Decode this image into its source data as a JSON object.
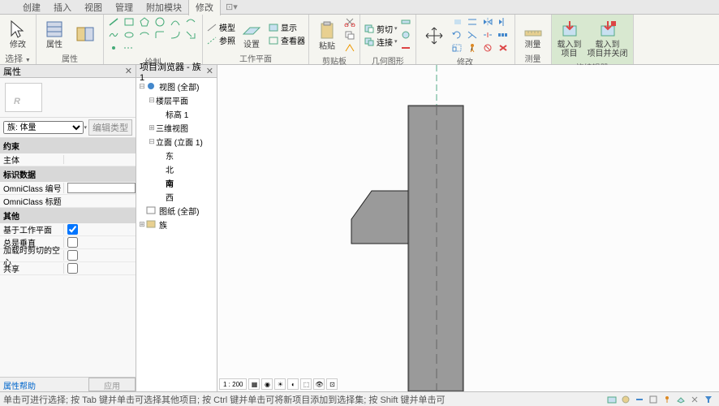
{
  "tabs": [
    "创建",
    "插入",
    "视图",
    "管理",
    "附加模块",
    "修改"
  ],
  "active_tab": 5,
  "ribbon": {
    "select": {
      "modify": "修改",
      "select_dd": "选择"
    },
    "properties": {
      "title": "属性",
      "btn": "属性"
    },
    "clipboard": {
      "title": "剪贴板",
      "paste": "粘贴"
    },
    "geometry": {
      "title": "几何图形",
      "join": "剪切",
      "connect": "连接"
    },
    "modify_grp": {
      "title": "修改"
    },
    "measure": {
      "title": "测量",
      "btn": "测量"
    },
    "draw": {
      "title": "绘制"
    },
    "workplane": {
      "title": "工作平面",
      "model": "模型",
      "ref": "参照",
      "show": "显示",
      "set": "设置",
      "viewer": "查看器"
    },
    "family_editor": {
      "title": "族编辑器",
      "load": "载入到\n项目",
      "load_close": "载入到\n项目并关闭"
    }
  },
  "properties_panel": {
    "title": "属性",
    "family_type": "族: 体量",
    "edit_type": "编辑类型",
    "constraints_section": "约束",
    "host": "主体",
    "identity_section": "标识数据",
    "omni_number": "OmniClass 编号",
    "omni_title": "OmniClass 标题",
    "other_section": "其他",
    "workplane_based": "基于工作平面",
    "always_vertical": "总是垂直",
    "cut_with_voids": "加载时剪切的空心",
    "shared": "共享",
    "help_link": "属性帮助",
    "apply": "应用"
  },
  "browser": {
    "title": "项目浏览器 - 族1",
    "views": "视图 (全部)",
    "floor_plans": "楼层平面",
    "level1": "标高 1",
    "views_3d": "三维视图",
    "elevations": "立面 (立面 1)",
    "east": "东",
    "north": "北",
    "south": "南",
    "west": "西",
    "sheets": "图纸 (全部)",
    "families": "族"
  },
  "canvas": {
    "scale": "1 : 200"
  },
  "status": {
    "hint": "单击可进行选择; 按 Tab 键并单击可选择其他项目; 按 Ctrl 键并单击可将新项目添加到选择集; 按 Shift 键并单击可"
  }
}
